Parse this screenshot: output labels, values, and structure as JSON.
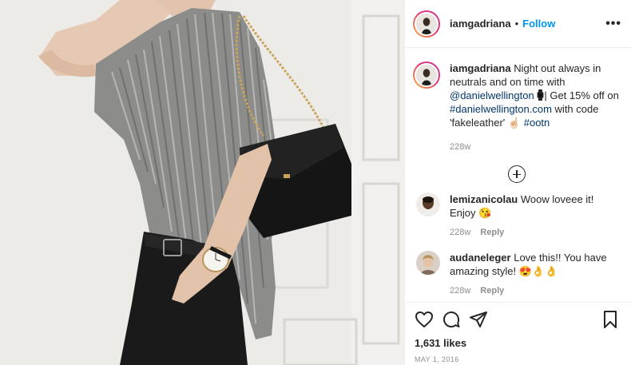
{
  "post": {
    "username": "iamgadriana",
    "dot": "•",
    "follow_label": "Follow",
    "more_label": "•••"
  },
  "caption": {
    "username": "iamgadriana",
    "text_1": "Night out always in neutrals and on time with",
    "mention": "@danielwellington",
    "text_2": "| Get 15% off on",
    "hashtag_link": "#danielwellington.com",
    "text_3": "with code 'fakeleather'",
    "emoji_hand": "☝🏻",
    "hashtag": "#ootn",
    "age": "228w"
  },
  "comments": [
    {
      "username": "lemizanicolau",
      "text": "Woow loveee it! Enjoy 😘",
      "age": "228w",
      "reply_label": "Reply"
    },
    {
      "username": "audaneleger",
      "text": "Love this!! You have amazing style! 😍👌👌",
      "age": "228w",
      "reply_label": "Reply"
    }
  ],
  "icons": {
    "like": "heart-icon",
    "comment": "comment-icon",
    "share": "paper-plane-icon",
    "save": "bookmark-icon",
    "load_more": "plus-circle-icon",
    "watch": "watch-emoji"
  },
  "likes": "1,631 likes",
  "date": "MAY 1, 2016",
  "colors": {
    "follow": "#0095f6",
    "link": "#00376b",
    "muted": "#8e8e8e",
    "border": "#efefef"
  }
}
